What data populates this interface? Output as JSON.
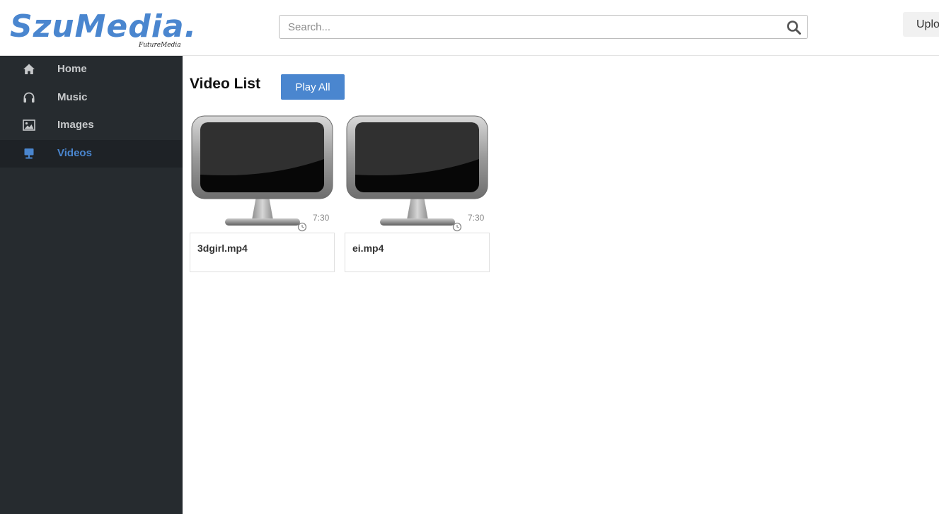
{
  "header": {
    "logo_text": "SzuMedia.",
    "logo_subtext": "FutureMedia",
    "search_placeholder": "Search...",
    "upload_label": "Upload"
  },
  "sidebar": {
    "items": [
      {
        "label": "Home",
        "icon": "home-icon",
        "active": false
      },
      {
        "label": "Music",
        "icon": "headphones-icon",
        "active": false
      },
      {
        "label": "Images",
        "icon": "image-icon",
        "active": false
      },
      {
        "label": "Videos",
        "icon": "monitor-icon",
        "active": true
      }
    ]
  },
  "main": {
    "title": "Video List",
    "play_all_label": "Play All",
    "videos": [
      {
        "name": "3dgirl.mp4",
        "duration": "7:30",
        "thumbnail": "monitor-thumbnail"
      },
      {
        "name": "ei.mp4",
        "duration": "7:30",
        "thumbnail": "monitor-thumbnail"
      }
    ]
  },
  "colors": {
    "accent": "#4a86cf",
    "sidebar_bg": "#262b2f",
    "sidebar_active_bg": "#1e2226",
    "sidebar_text": "#c7c9cb"
  }
}
